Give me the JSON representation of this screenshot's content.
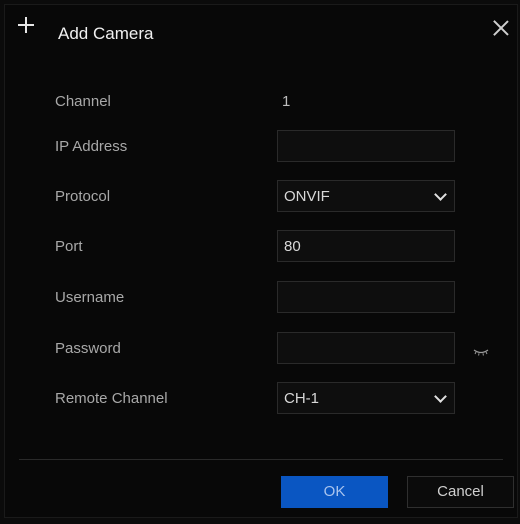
{
  "dialog": {
    "title": "Add Camera"
  },
  "form": {
    "channel": {
      "label": "Channel",
      "value": "1"
    },
    "ip_address": {
      "label": "IP Address",
      "value": ""
    },
    "protocol": {
      "label": "Protocol",
      "value": "ONVIF"
    },
    "port": {
      "label": "Port",
      "value": "80"
    },
    "username": {
      "label": "Username",
      "value": ""
    },
    "password": {
      "label": "Password",
      "value": ""
    },
    "remote_channel": {
      "label": "Remote Channel",
      "value": "CH-1"
    }
  },
  "footer": {
    "ok_label": "OK",
    "cancel_label": "Cancel"
  },
  "icons": {
    "title": "plus-icon",
    "close": "close-icon",
    "dropdown": "chevron-down-icon",
    "password_toggle": "eye-icon"
  },
  "colors": {
    "background": "#080808",
    "primary_button": "#0a56c2"
  }
}
